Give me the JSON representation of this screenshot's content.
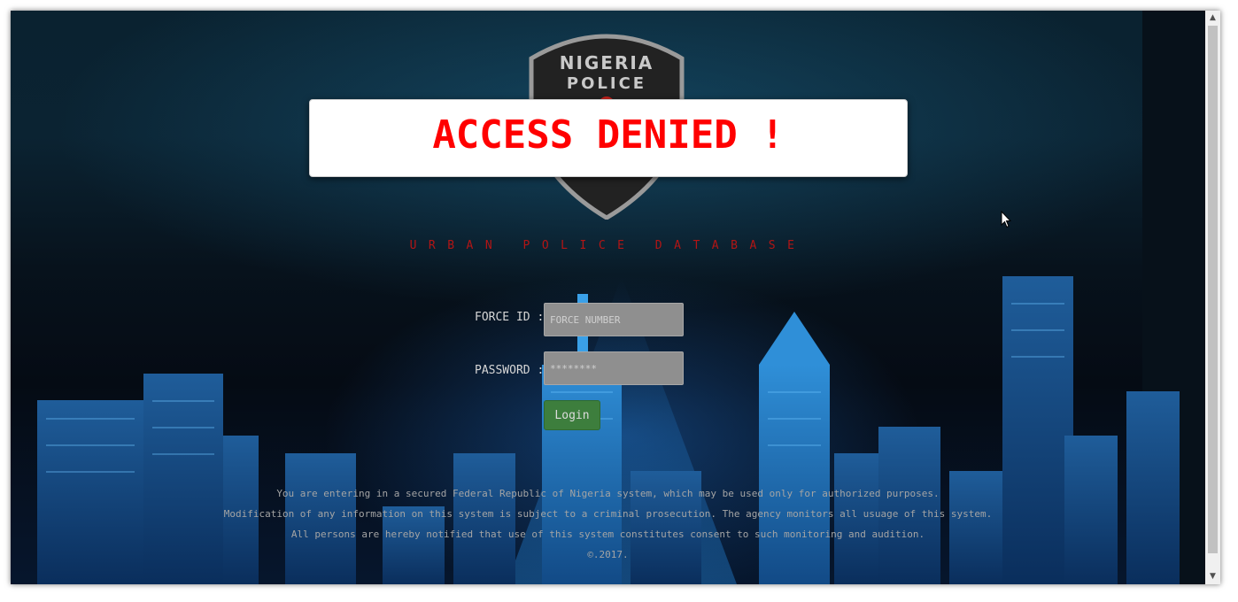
{
  "badge": {
    "line1": "NIGERIA",
    "line2": "POLICE"
  },
  "alert": {
    "message": "ACCESS DENIED !"
  },
  "subtitle": "URBAN POLICE DATABASE",
  "login_form": {
    "force_id_label": "FORCE ID :",
    "force_id_placeholder": "FORCE NUMBER",
    "password_label": "PASSWORD :",
    "password_placeholder": "********",
    "login_button": "Login"
  },
  "notice": {
    "line1": "You are entering in a secured Federal Republic of Nigeria system, which may be used only for authorized purposes.",
    "line2": "Modification of any information on this system is subject to a criminal prosecution. The agency monitors all usuage of this system.",
    "line3": "All persons are hereby notified that use of this system constitutes consent to such monitoring and audition.",
    "copyright": "©.2017."
  },
  "icons": {
    "scroll_up": "chevron-up-icon",
    "scroll_down": "chevron-down-icon",
    "cursor": "mouse-pointer-icon"
  },
  "colors": {
    "alert_text": "#ff0000",
    "subtitle_text": "#b31515",
    "login_button": "#3d7e3d",
    "badge_green": "#0f8a3a"
  }
}
